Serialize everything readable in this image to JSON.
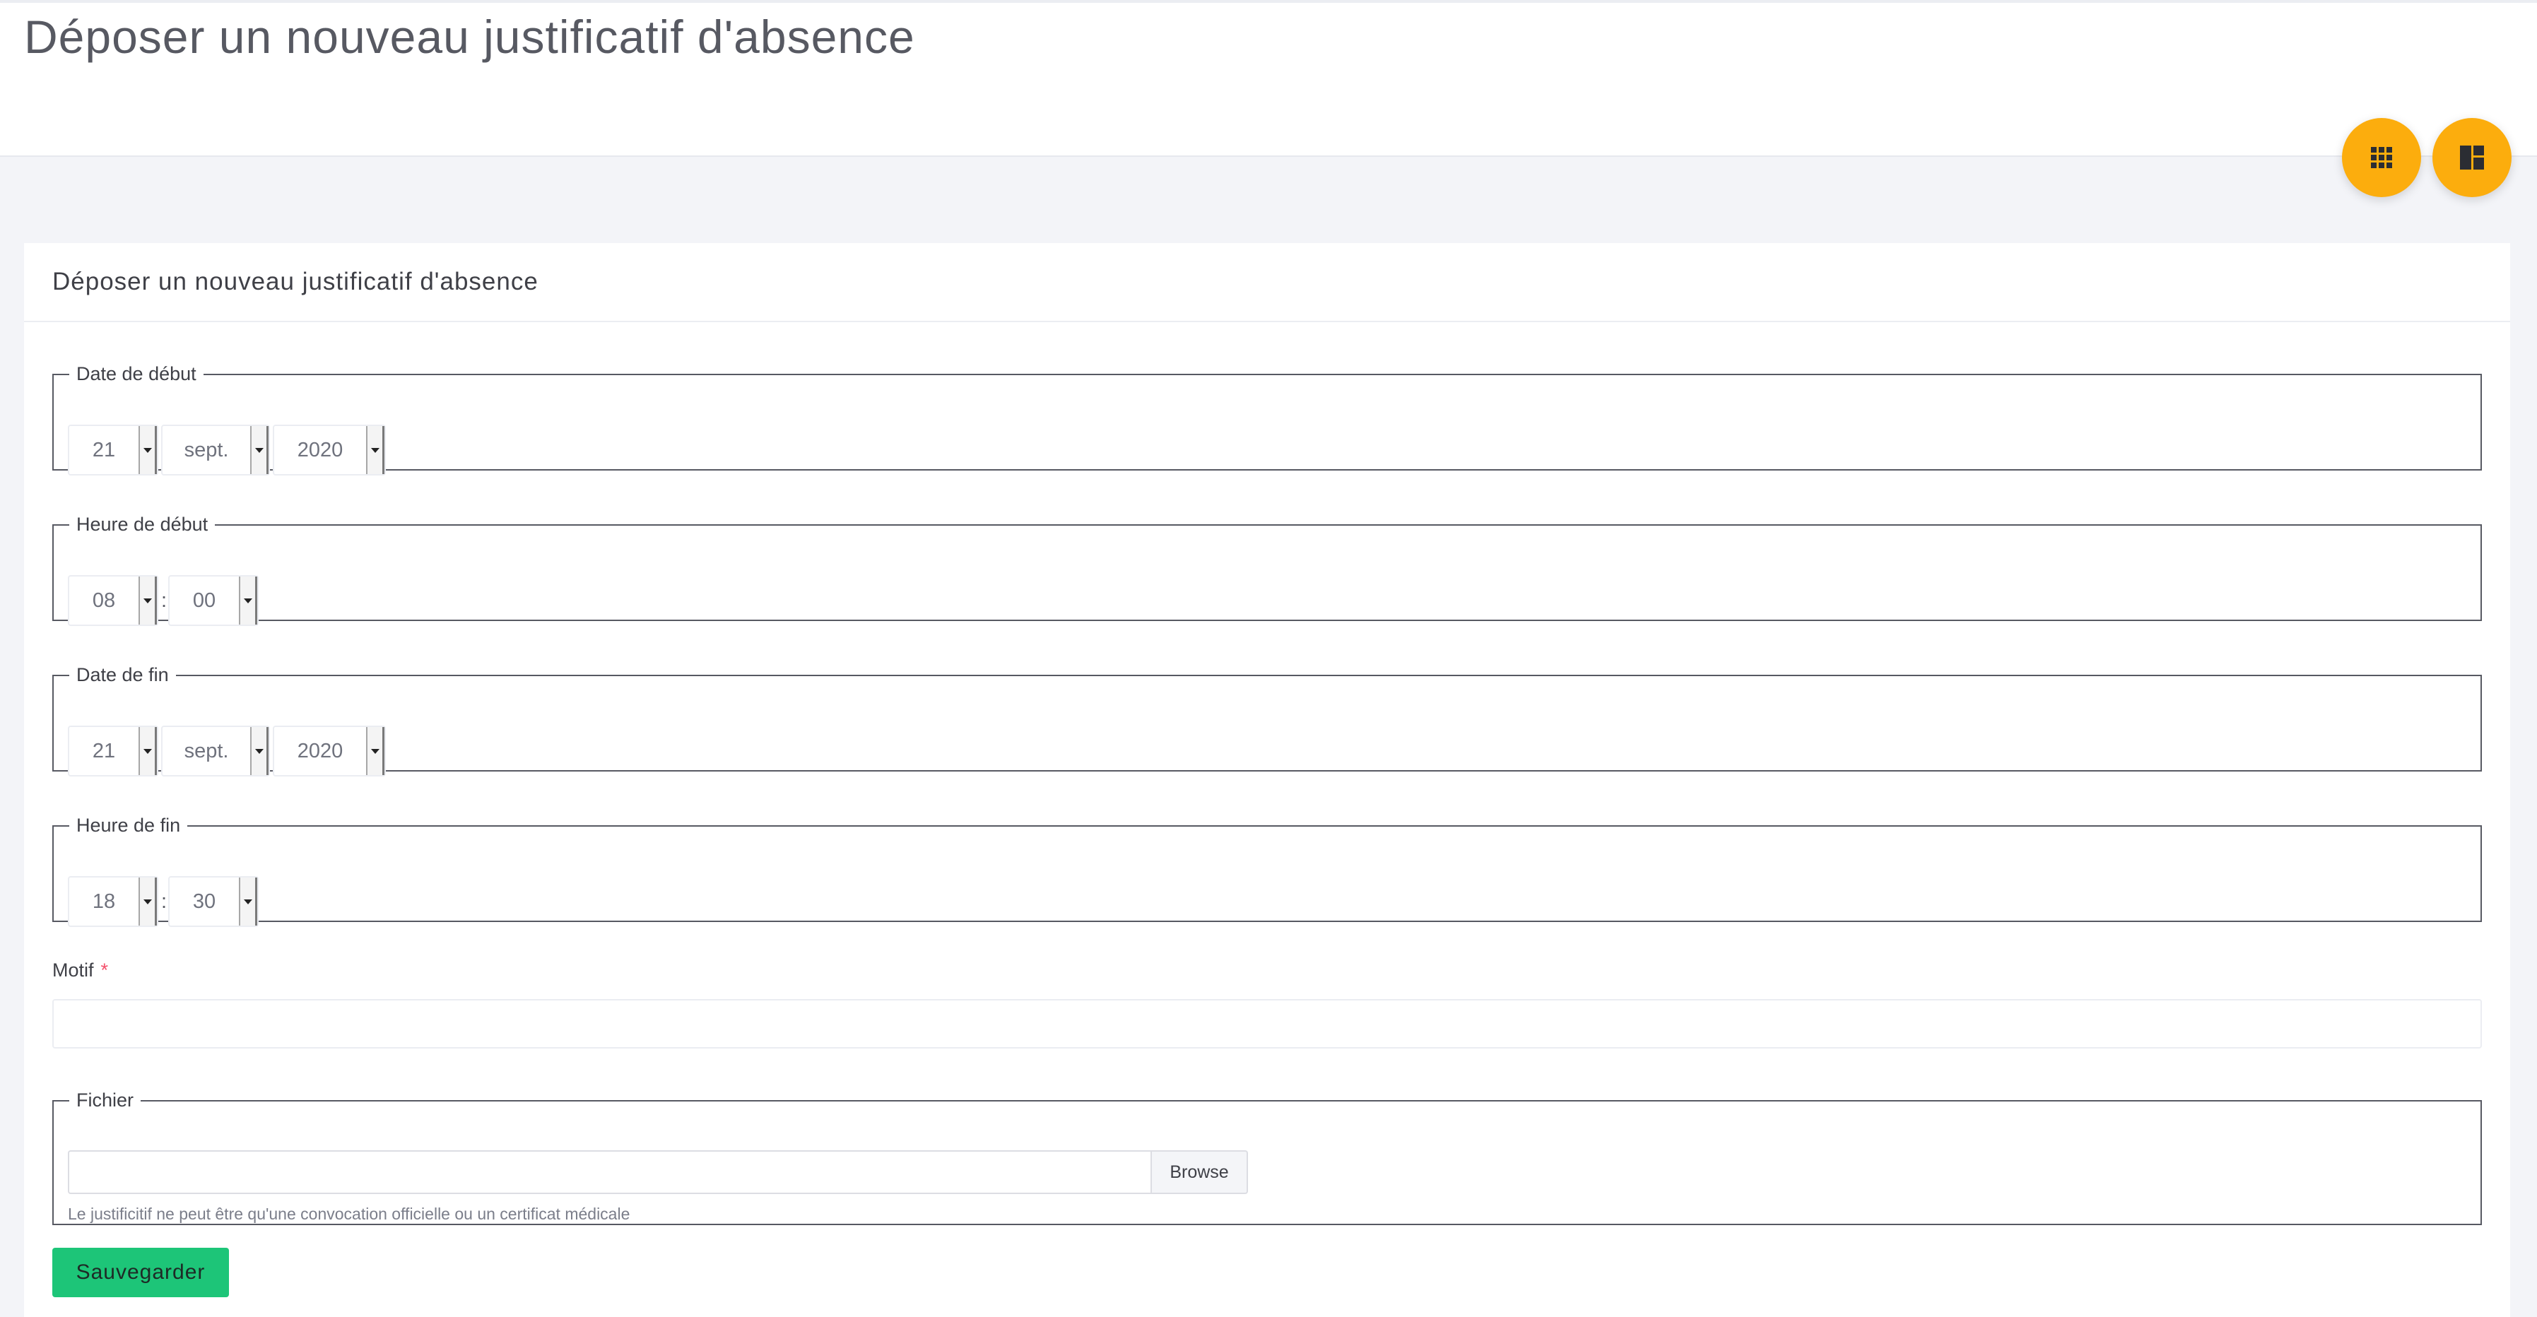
{
  "page": {
    "title": "Déposer un nouveau justificatif d'absence"
  },
  "fabs": {
    "apps_icon": "apps-grid-icon",
    "dashboard_icon": "dashboard-icon",
    "color": "#fcad0d"
  },
  "form": {
    "title": "Déposer un nouveau justificatif d'absence",
    "start_date": {
      "legend": "Date de début",
      "day": "21",
      "month": "sept.",
      "year": "2020"
    },
    "start_time": {
      "legend": "Heure de début",
      "hour": "08",
      "separator": ":",
      "minute": "00"
    },
    "end_date": {
      "legend": "Date de fin",
      "day": "21",
      "month": "sept.",
      "year": "2020"
    },
    "end_time": {
      "legend": "Heure de fin",
      "hour": "18",
      "separator": ":",
      "minute": "30"
    },
    "motif": {
      "label": "Motif",
      "required_mark": "*",
      "value": ""
    },
    "file": {
      "legend": "Fichier",
      "browse_label": "Browse",
      "hint": "Le justificitif ne peut être qu'une convocation officielle ou un certificat médicale"
    },
    "save_label": "Sauvegarder",
    "save_color": "#1dc578"
  }
}
